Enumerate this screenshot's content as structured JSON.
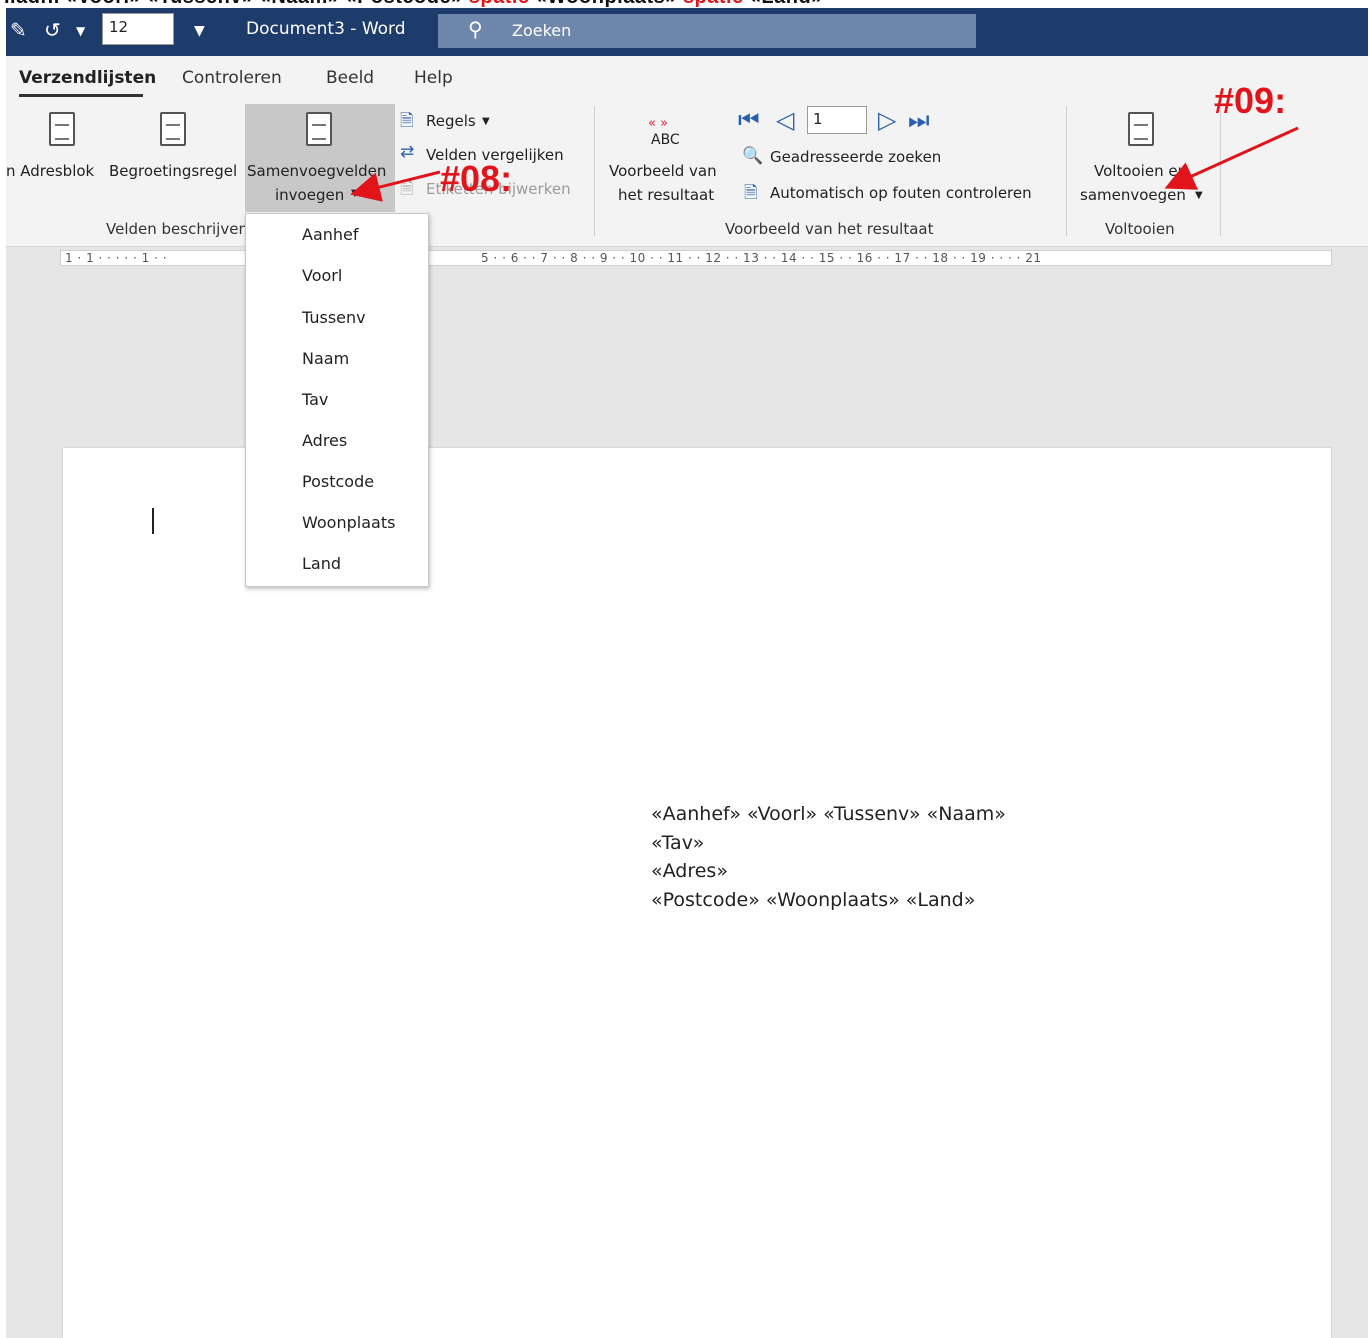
{
  "caption": {
    "parts": [
      {
        "text": "..adr.. «Voorl» «Tussenv» «Naam»   «Postcode» ",
        "red": false
      },
      {
        "text": "spatie",
        "red": true
      },
      {
        "text": " «Woonplaats» ",
        "red": false
      },
      {
        "text": "spatie",
        "red": true
      },
      {
        "text": " «Land»",
        "red": false
      }
    ]
  },
  "titlebar": {
    "font_size": "12",
    "doc_title": "Document3  -  Word",
    "search_label": "Zoeken"
  },
  "tabs": [
    "Verzendlijsten",
    "Controleren",
    "Beeld",
    "Help"
  ],
  "ribbon": {
    "adresblok": "n Adresblok",
    "begroetingsregel": "Begroetingsregel",
    "samenvoegvelden_1": "Samenvoegvelden",
    "samenvoegvelden_2": "invoegen",
    "regels": "Regels",
    "velden_vergelijken": "Velden vergelijken",
    "etiketten": "Etiketten bijwerken",
    "abc": "ABC",
    "voorbeeld_1": "Voorbeeld van",
    "voorbeeld_2": "het resultaat",
    "record": "1",
    "geadresseerde": "Geadresseerde zoeken",
    "automatisch": "Automatisch op fouten controleren",
    "voltooien_1": "Voltooien en",
    "voltooien_2": "samenvoegen",
    "group_velden": "Velden beschrijven",
    "group_voorbeeld": "Voorbeeld van het resultaat",
    "group_voltooien": "Voltooien"
  },
  "annotations": {
    "a08": "#08:",
    "a09": "#09:"
  },
  "ruler": {
    "left_nums": "1 · 1 · ·  · · · 1 · ·",
    "nums": "5 · · 6 · · 7 · · 8 · · 9 · · 10 · · 11 · · 12 · · 13 · · 14 · · 15 · · 16 · · 17 · · 18 · · 19 · ·    · · 21"
  },
  "menu_items": [
    "Aanhef",
    "Voorl",
    "Tussenv",
    "Naam",
    "Tav",
    "Adres",
    "Postcode",
    "Woonplaats",
    "Land"
  ],
  "address_lines": [
    "«Aanhef» «Voorl» «Tussenv» «Naam»",
    "«Tav»",
    "«Adres»",
    "«Postcode» «Woonplaats» «Land»"
  ],
  "colors": {
    "titlebar": "#1d3b6b",
    "search": "#6f87aa",
    "annotation": "#e0141a",
    "ribbon": "#f3f3f3"
  }
}
